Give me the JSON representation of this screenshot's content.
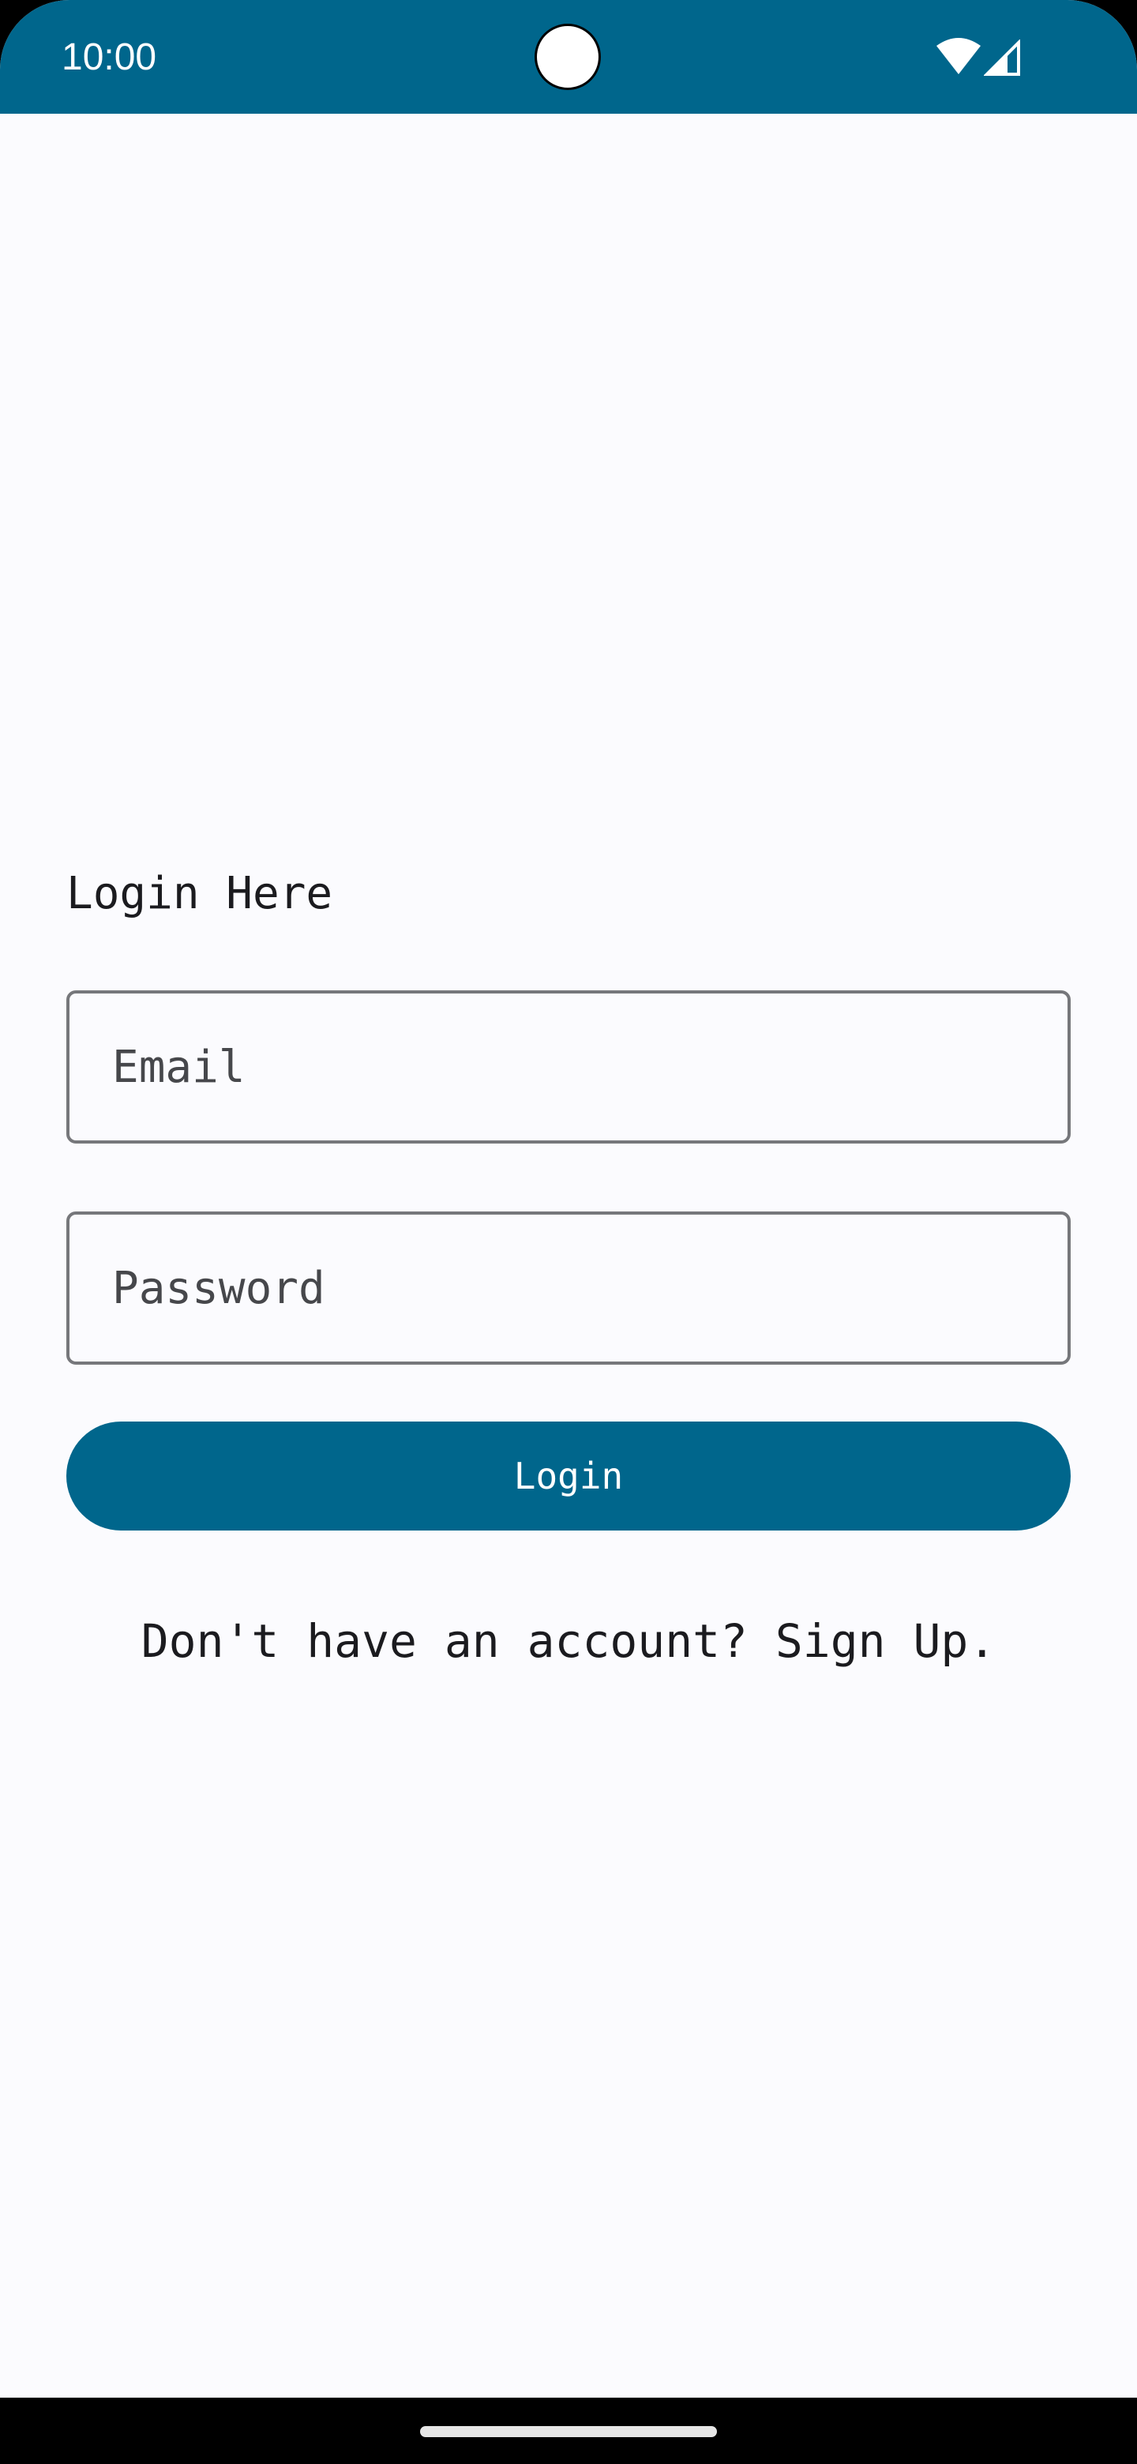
{
  "status_bar": {
    "time": "10:00",
    "icons": [
      "wifi-icon",
      "cellular-signal-icon"
    ],
    "color": "#00668c"
  },
  "login": {
    "heading": "Login Here",
    "email_placeholder": "Email",
    "email_value": "",
    "password_placeholder": "Password",
    "password_value": "",
    "button_label": "Login",
    "signup_prompt": "Don't have an account? Sign Up."
  },
  "colors": {
    "primary": "#00668c",
    "background": "#fbfbfe",
    "outline": "#76777b",
    "text": "#1b1b1f"
  }
}
